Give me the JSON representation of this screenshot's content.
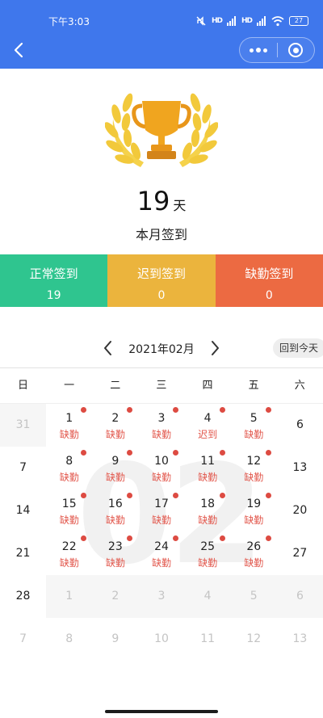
{
  "status_bar": {
    "time": "下午3:03",
    "signal1": "HD",
    "signal2": "HD",
    "battery": "27"
  },
  "summary": {
    "days": "19",
    "unit": "天",
    "label": "本月签到"
  },
  "stats": [
    {
      "label": "正常签到",
      "value": "19"
    },
    {
      "label": "迟到签到",
      "value": "0"
    },
    {
      "label": "缺勤签到",
      "value": "0"
    }
  ],
  "calendar": {
    "month": "2021年02月",
    "today_button": "回到今天",
    "watermark": "02",
    "weekdays": [
      "日",
      "一",
      "二",
      "三",
      "四",
      "五",
      "六"
    ],
    "rows": [
      [
        {
          "day": "31",
          "other": true
        },
        {
          "day": "1",
          "status": "缺勤"
        },
        {
          "day": "2",
          "status": "缺勤"
        },
        {
          "day": "3",
          "status": "缺勤"
        },
        {
          "day": "4",
          "status": "迟到"
        },
        {
          "day": "5",
          "status": "缺勤"
        },
        {
          "day": "6"
        }
      ],
      [
        {
          "day": "7"
        },
        {
          "day": "8",
          "status": "缺勤"
        },
        {
          "day": "9",
          "status": "缺勤"
        },
        {
          "day": "10",
          "status": "缺勤"
        },
        {
          "day": "11",
          "status": "缺勤"
        },
        {
          "day": "12",
          "status": "缺勤"
        },
        {
          "day": "13"
        }
      ],
      [
        {
          "day": "14"
        },
        {
          "day": "15",
          "status": "缺勤"
        },
        {
          "day": "16",
          "status": "缺勤"
        },
        {
          "day": "17",
          "status": "缺勤"
        },
        {
          "day": "18",
          "status": "缺勤"
        },
        {
          "day": "19",
          "status": "缺勤"
        },
        {
          "day": "20"
        }
      ],
      [
        {
          "day": "21"
        },
        {
          "day": "22",
          "status": "缺勤"
        },
        {
          "day": "23",
          "status": "缺勤"
        },
        {
          "day": "24",
          "status": "缺勤"
        },
        {
          "day": "25",
          "status": "缺勤"
        },
        {
          "day": "26",
          "status": "缺勤"
        },
        {
          "day": "27"
        }
      ],
      [
        {
          "day": "28"
        },
        {
          "day": "1",
          "other": true
        },
        {
          "day": "2",
          "other": true
        },
        {
          "day": "3",
          "other": true
        },
        {
          "day": "4",
          "other": true
        },
        {
          "day": "5",
          "other": true
        },
        {
          "day": "6",
          "other": true
        }
      ],
      [
        {
          "day": "7",
          "other": true
        },
        {
          "day": "8",
          "other": true
        },
        {
          "day": "9",
          "other": true
        },
        {
          "day": "10",
          "other": true
        },
        {
          "day": "11",
          "other": true
        },
        {
          "day": "12",
          "other": true
        },
        {
          "day": "13",
          "other": true
        }
      ]
    ]
  },
  "colors": {
    "header": "#3f77ec",
    "normal": "#2fc58f",
    "late": "#ebb43d",
    "absent": "#ec6a42",
    "mark": "#dd4b42"
  }
}
